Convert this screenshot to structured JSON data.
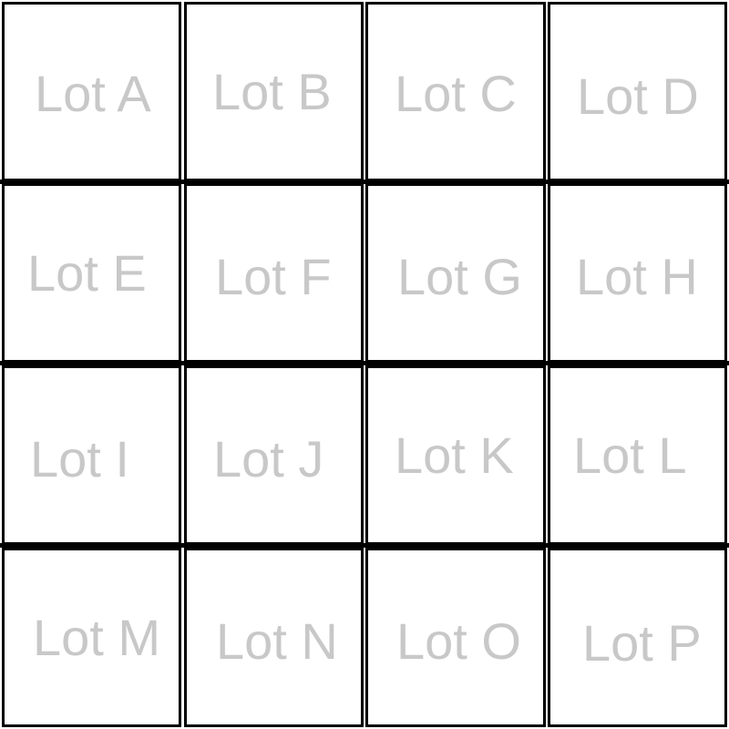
{
  "lots": [
    {
      "label": "Lot A"
    },
    {
      "label": "Lot B"
    },
    {
      "label": "Lot C"
    },
    {
      "label": "Lot D"
    },
    {
      "label": "Lot E"
    },
    {
      "label": "Lot F"
    },
    {
      "label": "Lot G"
    },
    {
      "label": "Lot H"
    },
    {
      "label": "Lot I"
    },
    {
      "label": "Lot J"
    },
    {
      "label": "Lot K"
    },
    {
      "label": "Lot L"
    },
    {
      "label": "Lot M"
    },
    {
      "label": "Lot N"
    },
    {
      "label": "Lot O"
    },
    {
      "label": "Lot P"
    }
  ],
  "colors": {
    "border": "#000000",
    "label": "#c8c8c8",
    "background": "#ffffff"
  }
}
